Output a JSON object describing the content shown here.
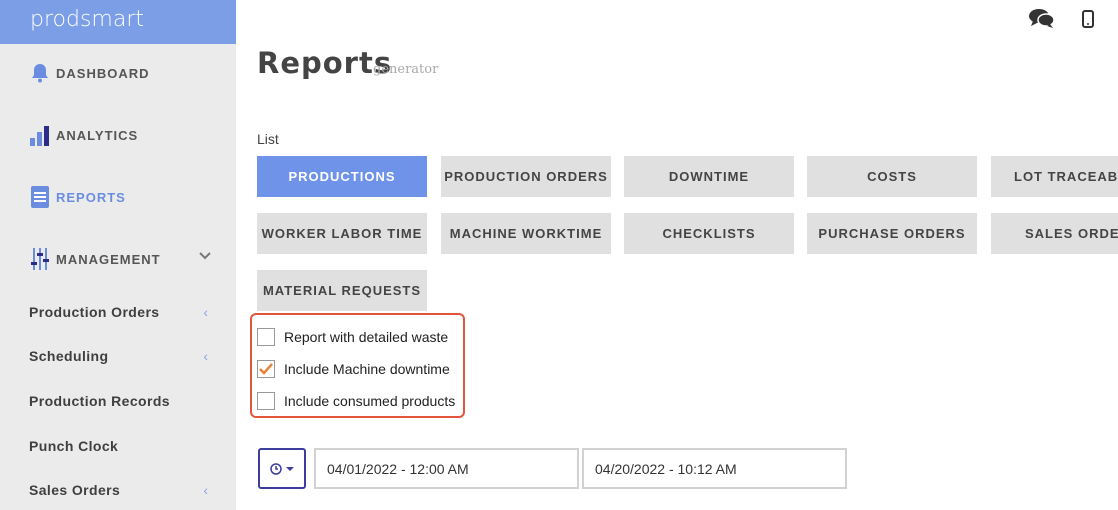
{
  "brand": "prodsmart",
  "nav": {
    "dashboard": "DASHBOARD",
    "analytics": "ANALYTICS",
    "reports": "REPORTS",
    "management": "MANAGEMENT",
    "sub": [
      "Production Orders",
      "Scheduling",
      "Production Records",
      "Punch Clock",
      "Sales Orders"
    ]
  },
  "page": {
    "title": "Reports",
    "subtitle": "generator",
    "list_label": "List"
  },
  "report_buttons": [
    "PRODUCTIONS",
    "PRODUCTION ORDERS",
    "DOWNTIME",
    "COSTS",
    "LOT TRACEABILITY",
    "WORKER LABOR TIME",
    "MACHINE WORKTIME",
    "CHECKLISTS",
    "PURCHASE ORDERS",
    "SALES ORDERS",
    "MATERIAL REQUESTS"
  ],
  "active_report": "PRODUCTIONS",
  "options": [
    {
      "label": "Report with detailed waste",
      "checked": false
    },
    {
      "label": "Include Machine downtime",
      "checked": true
    },
    {
      "label": "Include consumed products",
      "checked": false
    }
  ],
  "date_range": {
    "from": "04/01/2022 - 12:00 AM",
    "to": "04/20/2022 - 10:12 AM"
  },
  "colors": {
    "accent": "#6f93e8",
    "brand_bar": "#7b9ee6",
    "highlight_border": "#e2553b",
    "check": "#e8833a"
  }
}
